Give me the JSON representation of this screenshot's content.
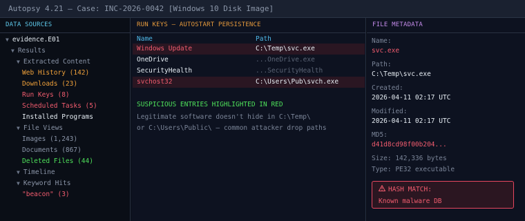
{
  "window": {
    "title": "Autopsy 4.21 — Case: INC-2026-0042 [Windows 10 Disk Image]"
  },
  "data_sources": {
    "header": "DATA SOURCES",
    "items": [
      {
        "label": "evidence.E01",
        "level": 0,
        "twisty": "▼",
        "color": "white"
      },
      {
        "label": "Results",
        "level": 1,
        "twisty": "▼",
        "color": "muted"
      },
      {
        "label": "Extracted Content",
        "level": 2,
        "twisty": "▼",
        "color": "muted"
      },
      {
        "label": "Web History (142)",
        "level": 3,
        "twisty": "",
        "color": "orange"
      },
      {
        "label": "Downloads (23)",
        "level": 3,
        "twisty": "",
        "color": "orange"
      },
      {
        "label": "Run Keys (8)",
        "level": 3,
        "twisty": "",
        "color": "red"
      },
      {
        "label": "Scheduled Tasks (5)",
        "level": 3,
        "twisty": "",
        "color": "red"
      },
      {
        "label": "Installed Programs",
        "level": 3,
        "twisty": "",
        "color": "white"
      },
      {
        "label": "File Views",
        "level": 2,
        "twisty": "▼",
        "color": "muted"
      },
      {
        "label": "Images (1,243)",
        "level": 3,
        "twisty": "",
        "color": "muted"
      },
      {
        "label": "Documents (867)",
        "level": 3,
        "twisty": "",
        "color": "muted"
      },
      {
        "label": "Deleted Files (44)",
        "level": 3,
        "twisty": "",
        "color": "green"
      },
      {
        "label": "Timeline",
        "level": 2,
        "twisty": "▼",
        "color": "muted"
      },
      {
        "label": "Keyword Hits",
        "level": 2,
        "twisty": "▼",
        "color": "muted"
      },
      {
        "label": "\"beacon\" (3)",
        "level": 3,
        "twisty": "",
        "color": "red"
      }
    ]
  },
  "run_keys": {
    "header": "RUN KEYS — AUTOSTART PERSISTENCE",
    "columns": {
      "name": "Name",
      "path": "Path"
    },
    "rows": [
      {
        "name": "Windows Update",
        "path": "C:\\Temp\\svc.exe",
        "suspicious": true
      },
      {
        "name": "OneDrive",
        "path": "...OneDrive.exe",
        "suspicious": false
      },
      {
        "name": "SecurityHealth",
        "path": "...SecurityHealth",
        "suspicious": false
      },
      {
        "name": "svchost32",
        "path": "C:\\Users\\Pub\\svch.exe",
        "suspicious": true
      }
    ],
    "note_title": "SUSPICIOUS ENTRIES HIGHLIGHTED IN RED",
    "note_line1": "Legitimate software doesn't hide in C:\\Temp\\",
    "note_line2": "or C:\\Users\\Public\\ — common attacker drop paths"
  },
  "metadata": {
    "header": "FILE METADATA",
    "name_label": "Name:",
    "name_value": "svc.exe",
    "path_label": "Path:",
    "path_value": "C:\\Temp\\svc.exe",
    "created_label": "Created:",
    "created_value": "2026-04-11 02:17 UTC",
    "modified_label": "Modified:",
    "modified_value": "2026-04-11 02:17 UTC",
    "md5_label": "MD5:",
    "md5_value": "d41d8cd98f00b204...",
    "size_text": "Size: 142,336 bytes",
    "type_text": "Type: PE32 executable",
    "alert_title": "HASH MATCH:",
    "alert_desc": "Known malware DB",
    "alert_icon": "warning-triangle-icon"
  },
  "colors": {
    "background": "#0b0f17",
    "accent_blue": "#5ec8ea",
    "accent_orange": "#f0a13a",
    "suspicious_red": "#f25c6e",
    "success_green": "#4ee05a",
    "metadata_purple": "#c28ae8"
  }
}
